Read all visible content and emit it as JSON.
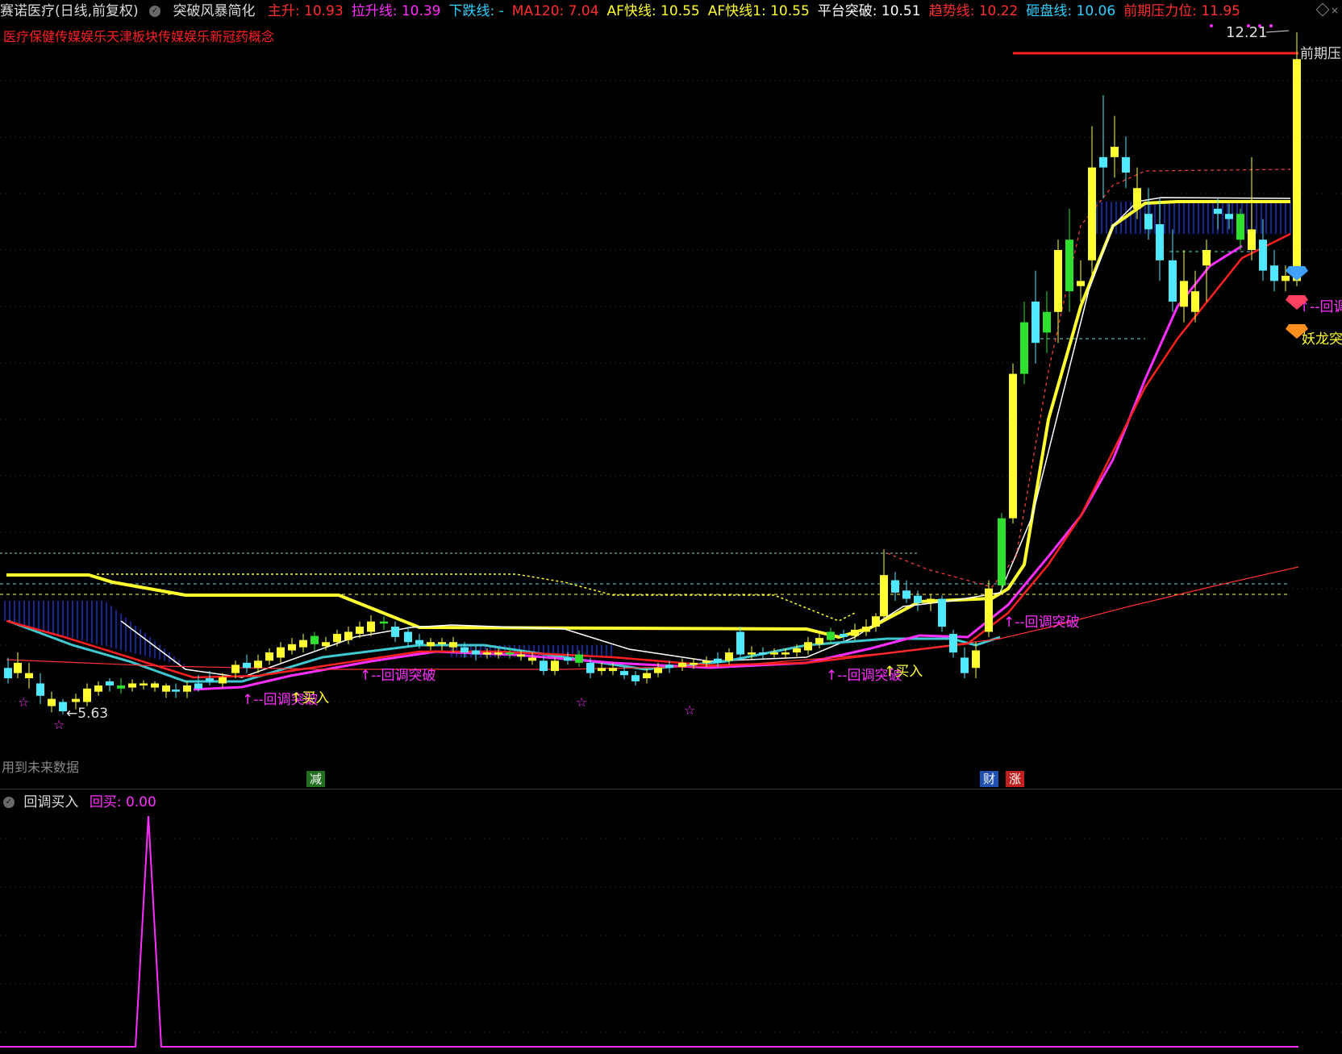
{
  "header": {
    "stock_title": "赛诺医疗(日线,前复权)",
    "indicator_name": "突破风暴简化",
    "metrics": [
      {
        "label": "主升: 10.93",
        "color": "#ff3030"
      },
      {
        "label": "拉升线: 10.39",
        "color": "#ff30ff"
      },
      {
        "label": "下跌线: -",
        "color": "#30d0ff"
      },
      {
        "label": "MA120: 7.04",
        "color": "#ff3030"
      },
      {
        "label": "AF快线: 10.55",
        "color": "#ffff30"
      },
      {
        "label": "AF快线1: 10.55",
        "color": "#ffff30"
      },
      {
        "label": "平台突破: 10.51",
        "color": "#ffffff"
      },
      {
        "label": "趋势线: 10.22",
        "color": "#ff3030"
      },
      {
        "label": "砸盘线: 10.06",
        "color": "#30d0ff"
      },
      {
        "label": "前期压力位: 11.95",
        "color": "#ff3030"
      }
    ]
  },
  "concepts": "医疗保健传媒娱乐天津板块传媒娱乐新冠药概念",
  "annotations": {
    "high_price": "12.21",
    "low_price": "5.63",
    "pressure_label": "前期压",
    "pullback_breakout": "--回调突破",
    "pullback_breakout_right": "--回调",
    "buy": "买入",
    "demon_dragon": "妖龙突",
    "star": "☆"
  },
  "footer": {
    "future_data": "用到未来数据",
    "tag_jian": "减",
    "tag_cai": "财",
    "tag_zhang": "涨"
  },
  "sub_panel": {
    "name": "回调买入",
    "value_label": "回买: 0.00",
    "value_color": "#ff30ff"
  },
  "colors": {
    "up": "#ffff30",
    "down": "#50e8ff",
    "green": "#30e030",
    "red_line": "#ff2020",
    "magenta": "#ff30ff",
    "white_line": "#ffffff",
    "yellow_line": "#ffff30",
    "blue_bar": "#2030c0"
  }
}
